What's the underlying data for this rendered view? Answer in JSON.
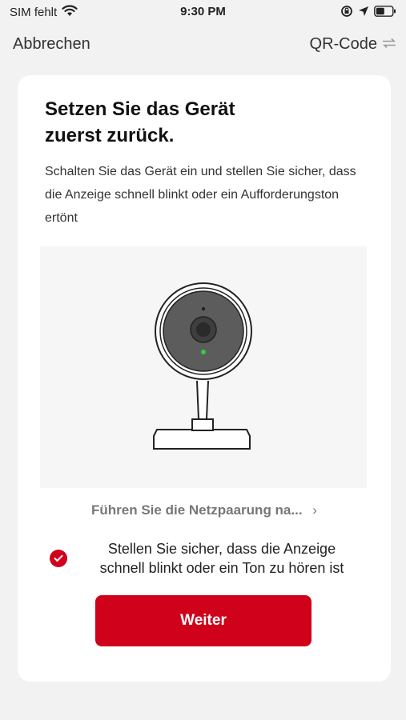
{
  "status_bar": {
    "carrier": "SIM fehlt",
    "time": "9:30 PM",
    "icons": [
      "wifi-icon",
      "orientation-lock-icon",
      "location-icon",
      "battery-icon"
    ]
  },
  "nav": {
    "cancel_label": "Abbrechen",
    "qr_label": "QR-Code",
    "qr_icon": "switch-arrows-icon"
  },
  "card": {
    "title_line1": "Setzen Sie das Gerät",
    "title_line2": "zuerst zurück.",
    "description": "Schalten Sie das Gerät ein und stellen Sie sicher, dass die Anzeige schnell blinkt oder ein Aufforderungston ertönt",
    "image": "camera-device-illustration",
    "guide_link_label": "Führen Sie die Netzpaarung na...",
    "confirm_line1": "Stellen Sie sicher, dass die Anzeige",
    "confirm_line2": "schnell blinkt oder ein Ton zu hören ist",
    "confirm_checked": true,
    "button_label": "Weiter"
  },
  "colors": {
    "accent": "#d0021b",
    "background": "#f2f2f2",
    "card": "#ffffff",
    "led": "#2ecc40"
  }
}
